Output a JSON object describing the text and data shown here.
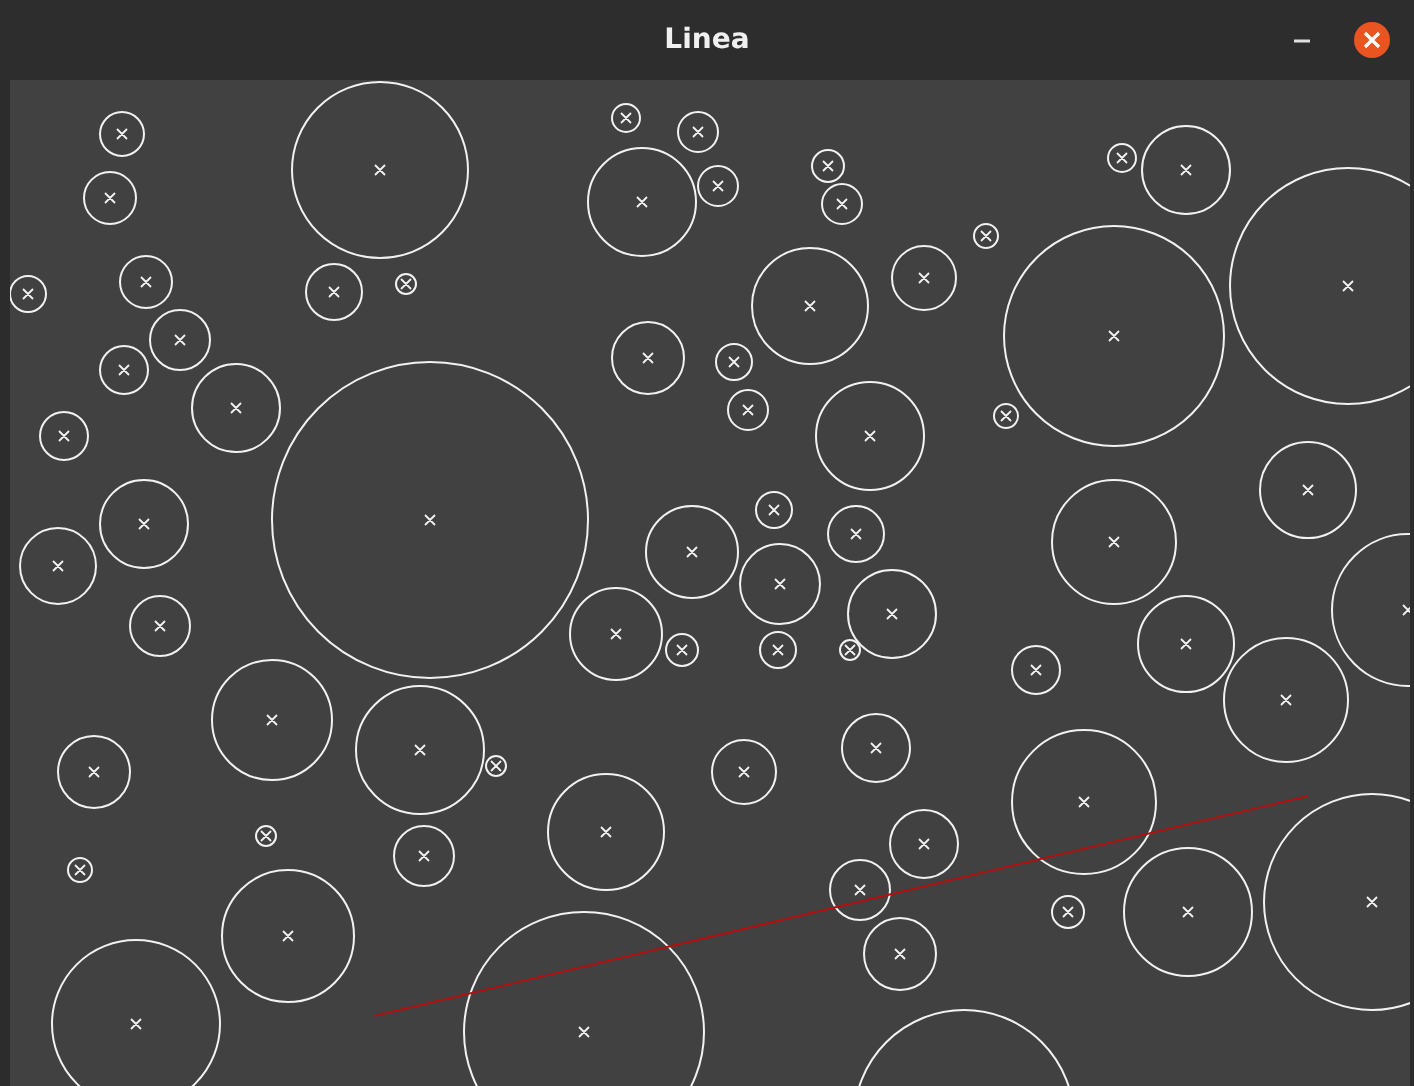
{
  "window": {
    "title": "Linea"
  }
}
